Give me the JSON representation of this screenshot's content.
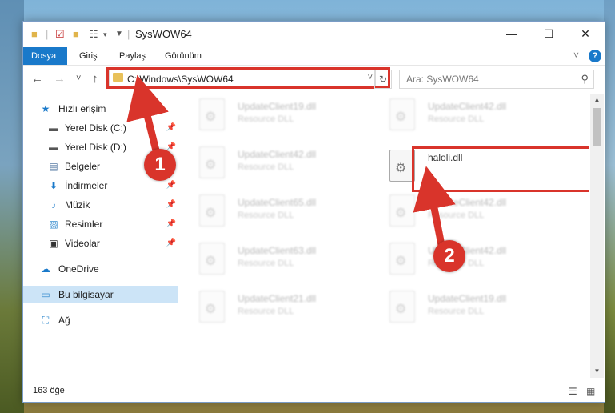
{
  "window": {
    "title": "SysWOW64",
    "min_glyph": "—",
    "max_glyph": "☐",
    "close_glyph": "✕"
  },
  "ribbon": {
    "tabs": [
      {
        "label": "Dosya",
        "active": true
      },
      {
        "label": "Giriş"
      },
      {
        "label": "Paylaş"
      },
      {
        "label": "Görünüm"
      }
    ],
    "collapse_glyph": "˅",
    "help_glyph": "?"
  },
  "nav": {
    "back_glyph": "←",
    "forward_glyph": "→",
    "recent_glyph": "˅",
    "up_glyph": "↑",
    "address": "C:\\Windows\\SysWOW64",
    "address_drop_glyph": "˅",
    "refresh_glyph": "↻",
    "search_placeholder": "Ara: SysWOW64",
    "search_glyph": "⚲"
  },
  "sidebar": {
    "quick_access": "Hızlı erişim",
    "items": [
      {
        "label": "Yerel Disk (C:)",
        "icon": "drive-icon",
        "pinned": true
      },
      {
        "label": "Yerel Disk (D:)",
        "icon": "drive-icon",
        "pinned": true
      },
      {
        "label": "Belgeler",
        "icon": "documents-icon",
        "pinned": true
      },
      {
        "label": "İndirmeler",
        "icon": "downloads-icon",
        "pinned": true
      },
      {
        "label": "Müzik",
        "icon": "music-icon",
        "pinned": true
      },
      {
        "label": "Resimler",
        "icon": "pictures-icon",
        "pinned": true
      },
      {
        "label": "Videolar",
        "icon": "videos-icon",
        "pinned": true
      }
    ],
    "onedrive": "OneDrive",
    "this_pc": "Bu bilgisayar",
    "network": "Ağ"
  },
  "files": [
    {
      "name": "UpdateClient19.dll",
      "type": "Resource DLL"
    },
    {
      "name": "UpdateClient42.dll",
      "type": "Resource DLL"
    },
    {
      "name": "UpdateClient42.dll",
      "type": "Resource DLL"
    },
    {
      "name": "haloli.dll",
      "type": ""
    },
    {
      "name": "UpdateClient65.dll",
      "type": "Resource DLL"
    },
    {
      "name": "UpdateClient42.dll",
      "type": "Resource DLL"
    },
    {
      "name": "UpdateClient63.dll",
      "type": "Resource DLL"
    },
    {
      "name": "UpdateClient42.dll",
      "type": "Resource DLL"
    },
    {
      "name": "UpdateClient21.dll",
      "type": "Resource DLL"
    },
    {
      "name": "UpdateClient19.dll",
      "type": "Resource DLL"
    }
  ],
  "status": {
    "count": "163 öğe"
  },
  "callouts": {
    "one": "1",
    "two": "2"
  },
  "colors": {
    "accent": "#1979ca",
    "highlight": "#d9342b",
    "selected": "#cce4f7"
  }
}
